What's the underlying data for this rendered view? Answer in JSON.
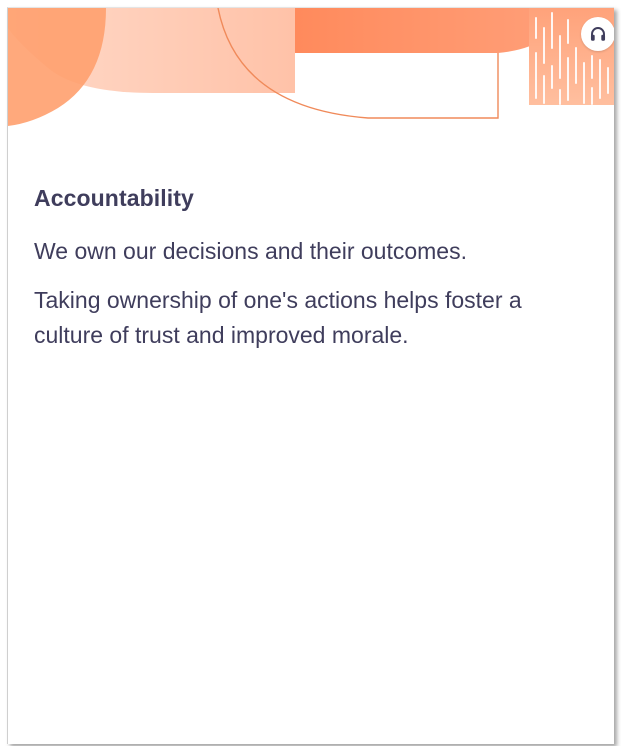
{
  "card": {
    "title": "Accountability",
    "paragraphs": [
      "We own our decisions and their outcomes.",
      "Taking ownership of one's actions helps foster a culture of trust and improved morale."
    ]
  },
  "banner": {
    "icon": "headphones-icon"
  },
  "colors": {
    "text": "#3f3d5c",
    "accent_orange": "#ff8c5a",
    "accent_peach": "#ffc9b0",
    "line": "#f08a5a"
  }
}
